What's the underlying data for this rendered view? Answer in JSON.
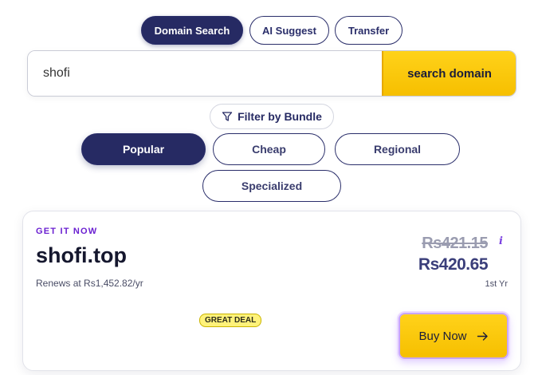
{
  "tabs": [
    {
      "label": "Domain Search",
      "active": true
    },
    {
      "label": "AI Suggest",
      "active": false
    },
    {
      "label": "Transfer",
      "active": false
    }
  ],
  "search": {
    "value": "shofi",
    "button_label": "search domain"
  },
  "filter": {
    "label": "Filter by Bundle",
    "icon": "funnel-icon"
  },
  "bundles": [
    {
      "label": "Popular",
      "active": true
    },
    {
      "label": "Cheap",
      "active": false
    },
    {
      "label": "Regional",
      "active": false
    },
    {
      "label": "Specialized",
      "active": false
    }
  ],
  "result": {
    "eyebrow": "GET IT NOW",
    "domain": "shofi.top",
    "renewal": "Renews at Rs1,452.82/yr",
    "old_price": "Rs421.15",
    "info": "i",
    "price": "Rs420.65",
    "period": "1st Yr",
    "badge": "GREAT DEAL",
    "buy_label": "Buy Now"
  },
  "colors": {
    "navy": "#262a63",
    "accent_yellow": "#f6bf00",
    "purple": "#6a1fd1"
  }
}
